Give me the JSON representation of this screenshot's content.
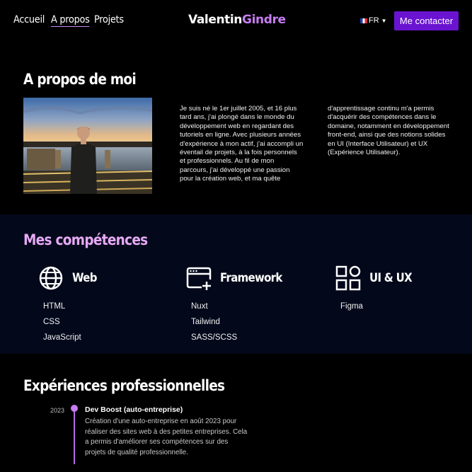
{
  "nav": {
    "links": [
      "Accueil",
      "A propos",
      "Projets"
    ],
    "logo_first": "Valentin",
    "logo_last": "Gindre",
    "lang": "FR",
    "contact_label": "Me contacter"
  },
  "about": {
    "title": "A propos de moi",
    "para1": "Je suis né le 1er juillet 2005, et 16 plus tard ans, j'ai plongé dans le monde du développement web en regardant des tutoriels en ligne. Avec plusieurs années d'expérience à mon actif, j'ai accompli un éventail de projets, à la fois personnels et professionnels. Au fil de mon parcours, j'ai développé une passion pour la création web, et ma quête",
    "para2": "d'apprentissage continu m'a permis d'acquérir des compétences dans le domaine, notamment en développement front-end, ainsi que des notions solides en UI (Interface Utilisateur) et UX (Expérience Utilisateur)."
  },
  "skills": {
    "title": "Mes compétences",
    "groups": [
      {
        "name": "Web",
        "icon": "globe-icon",
        "items": [
          "HTML",
          "CSS",
          "JavaScript"
        ]
      },
      {
        "name": "Framework",
        "icon": "browser-add-icon",
        "items": [
          "Nuxt",
          "Tailwind",
          "SASS/SCSS"
        ]
      },
      {
        "name": "UI & UX",
        "icon": "grid-icon",
        "items": [
          "Figma"
        ]
      }
    ]
  },
  "experience": {
    "title": "Expériences professionnelles",
    "items": [
      {
        "year": "2023",
        "role": "Dev Boost (auto-entreprise)",
        "description": "Création d'une auto-entreprise en août 2023 pour réaliser des sites web à des petites entreprises. Cela a permis d'améliorer ses compétences sur des projets de qualité professionnelle."
      }
    ]
  },
  "colors": {
    "accent": "#c77df0",
    "button": "#6a14d1",
    "skills_bg": "#03081a"
  }
}
